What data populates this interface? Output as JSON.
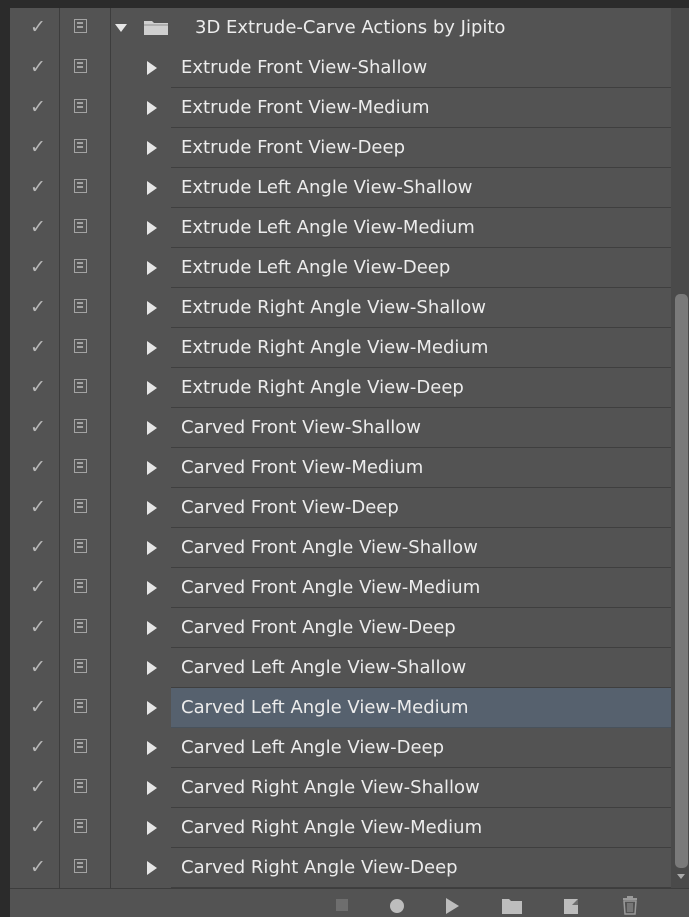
{
  "set": {
    "name": "3D Extrude-Carve Actions by Jipito",
    "checked": true,
    "expanded": true
  },
  "actions": [
    {
      "label": "Extrude Front View-Shallow"
    },
    {
      "label": "Extrude Front View-Medium"
    },
    {
      "label": "Extrude Front View-Deep"
    },
    {
      "label": "Extrude Left Angle View-Shallow"
    },
    {
      "label": "Extrude Left Angle View-Medium"
    },
    {
      "label": "Extrude Left Angle View-Deep"
    },
    {
      "label": "Extrude Right Angle View-Shallow"
    },
    {
      "label": "Extrude Right Angle View-Medium"
    },
    {
      "label": "Extrude Right Angle View-Deep"
    },
    {
      "label": "Carved Front View-Shallow"
    },
    {
      "label": "Carved Front View-Medium"
    },
    {
      "label": "Carved Front View-Deep"
    },
    {
      "label": "Carved Front Angle View-Shallow"
    },
    {
      "label": "Carved Front Angle View-Medium"
    },
    {
      "label": "Carved Front Angle View-Deep"
    },
    {
      "label": "Carved Left Angle View-Shallow"
    },
    {
      "label": "Carved Left Angle View-Medium",
      "selected": true
    },
    {
      "label": "Carved Left Angle View-Deep"
    },
    {
      "label": "Carved Right Angle View-Shallow"
    },
    {
      "label": "Carved Right Angle View-Medium"
    },
    {
      "label": "Carved Right Angle View-Deep"
    }
  ],
  "icons": {
    "check": "✓",
    "toggle_dialog": "dialog-toggle-icon",
    "expand": "triangle-right-icon",
    "collapse": "triangle-down-icon",
    "set_folder": "folder-icon"
  },
  "toolbar": {
    "buttons": [
      "stop-icon",
      "record-icon",
      "play-icon",
      "new-set-icon",
      "new-action-icon",
      "delete-icon"
    ]
  },
  "colors": {
    "panel_bg": "#535353",
    "selected_bg": "#56616e",
    "text": "#ececec"
  }
}
